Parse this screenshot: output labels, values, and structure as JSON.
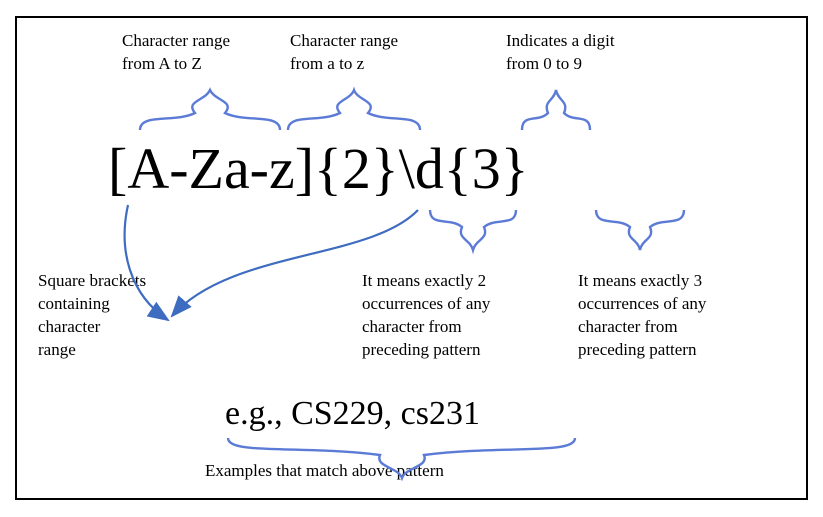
{
  "regex_pattern": "[A-Za-z]{2}\\d{3}",
  "annotations": {
    "upper_range": "Character range\nfrom A to Z",
    "lower_range": "Character range\nfrom a to z",
    "digit": "Indicates a digit\nfrom 0 to 9",
    "brackets": "Square brackets\ncontaining\ncharacter\nrange",
    "quant2": "It means exactly 2\noccurrences of any\ncharacter from\npreceding pattern",
    "quant3": "It means exactly 3\noccurrences of any\ncharacter from\npreceding pattern",
    "examples_caption": "Examples that match above pattern"
  },
  "examples_text": "e.g., CS229, cs231",
  "colors": {
    "brace": "#5B7BD6",
    "arrow": "#3E6CC0"
  }
}
